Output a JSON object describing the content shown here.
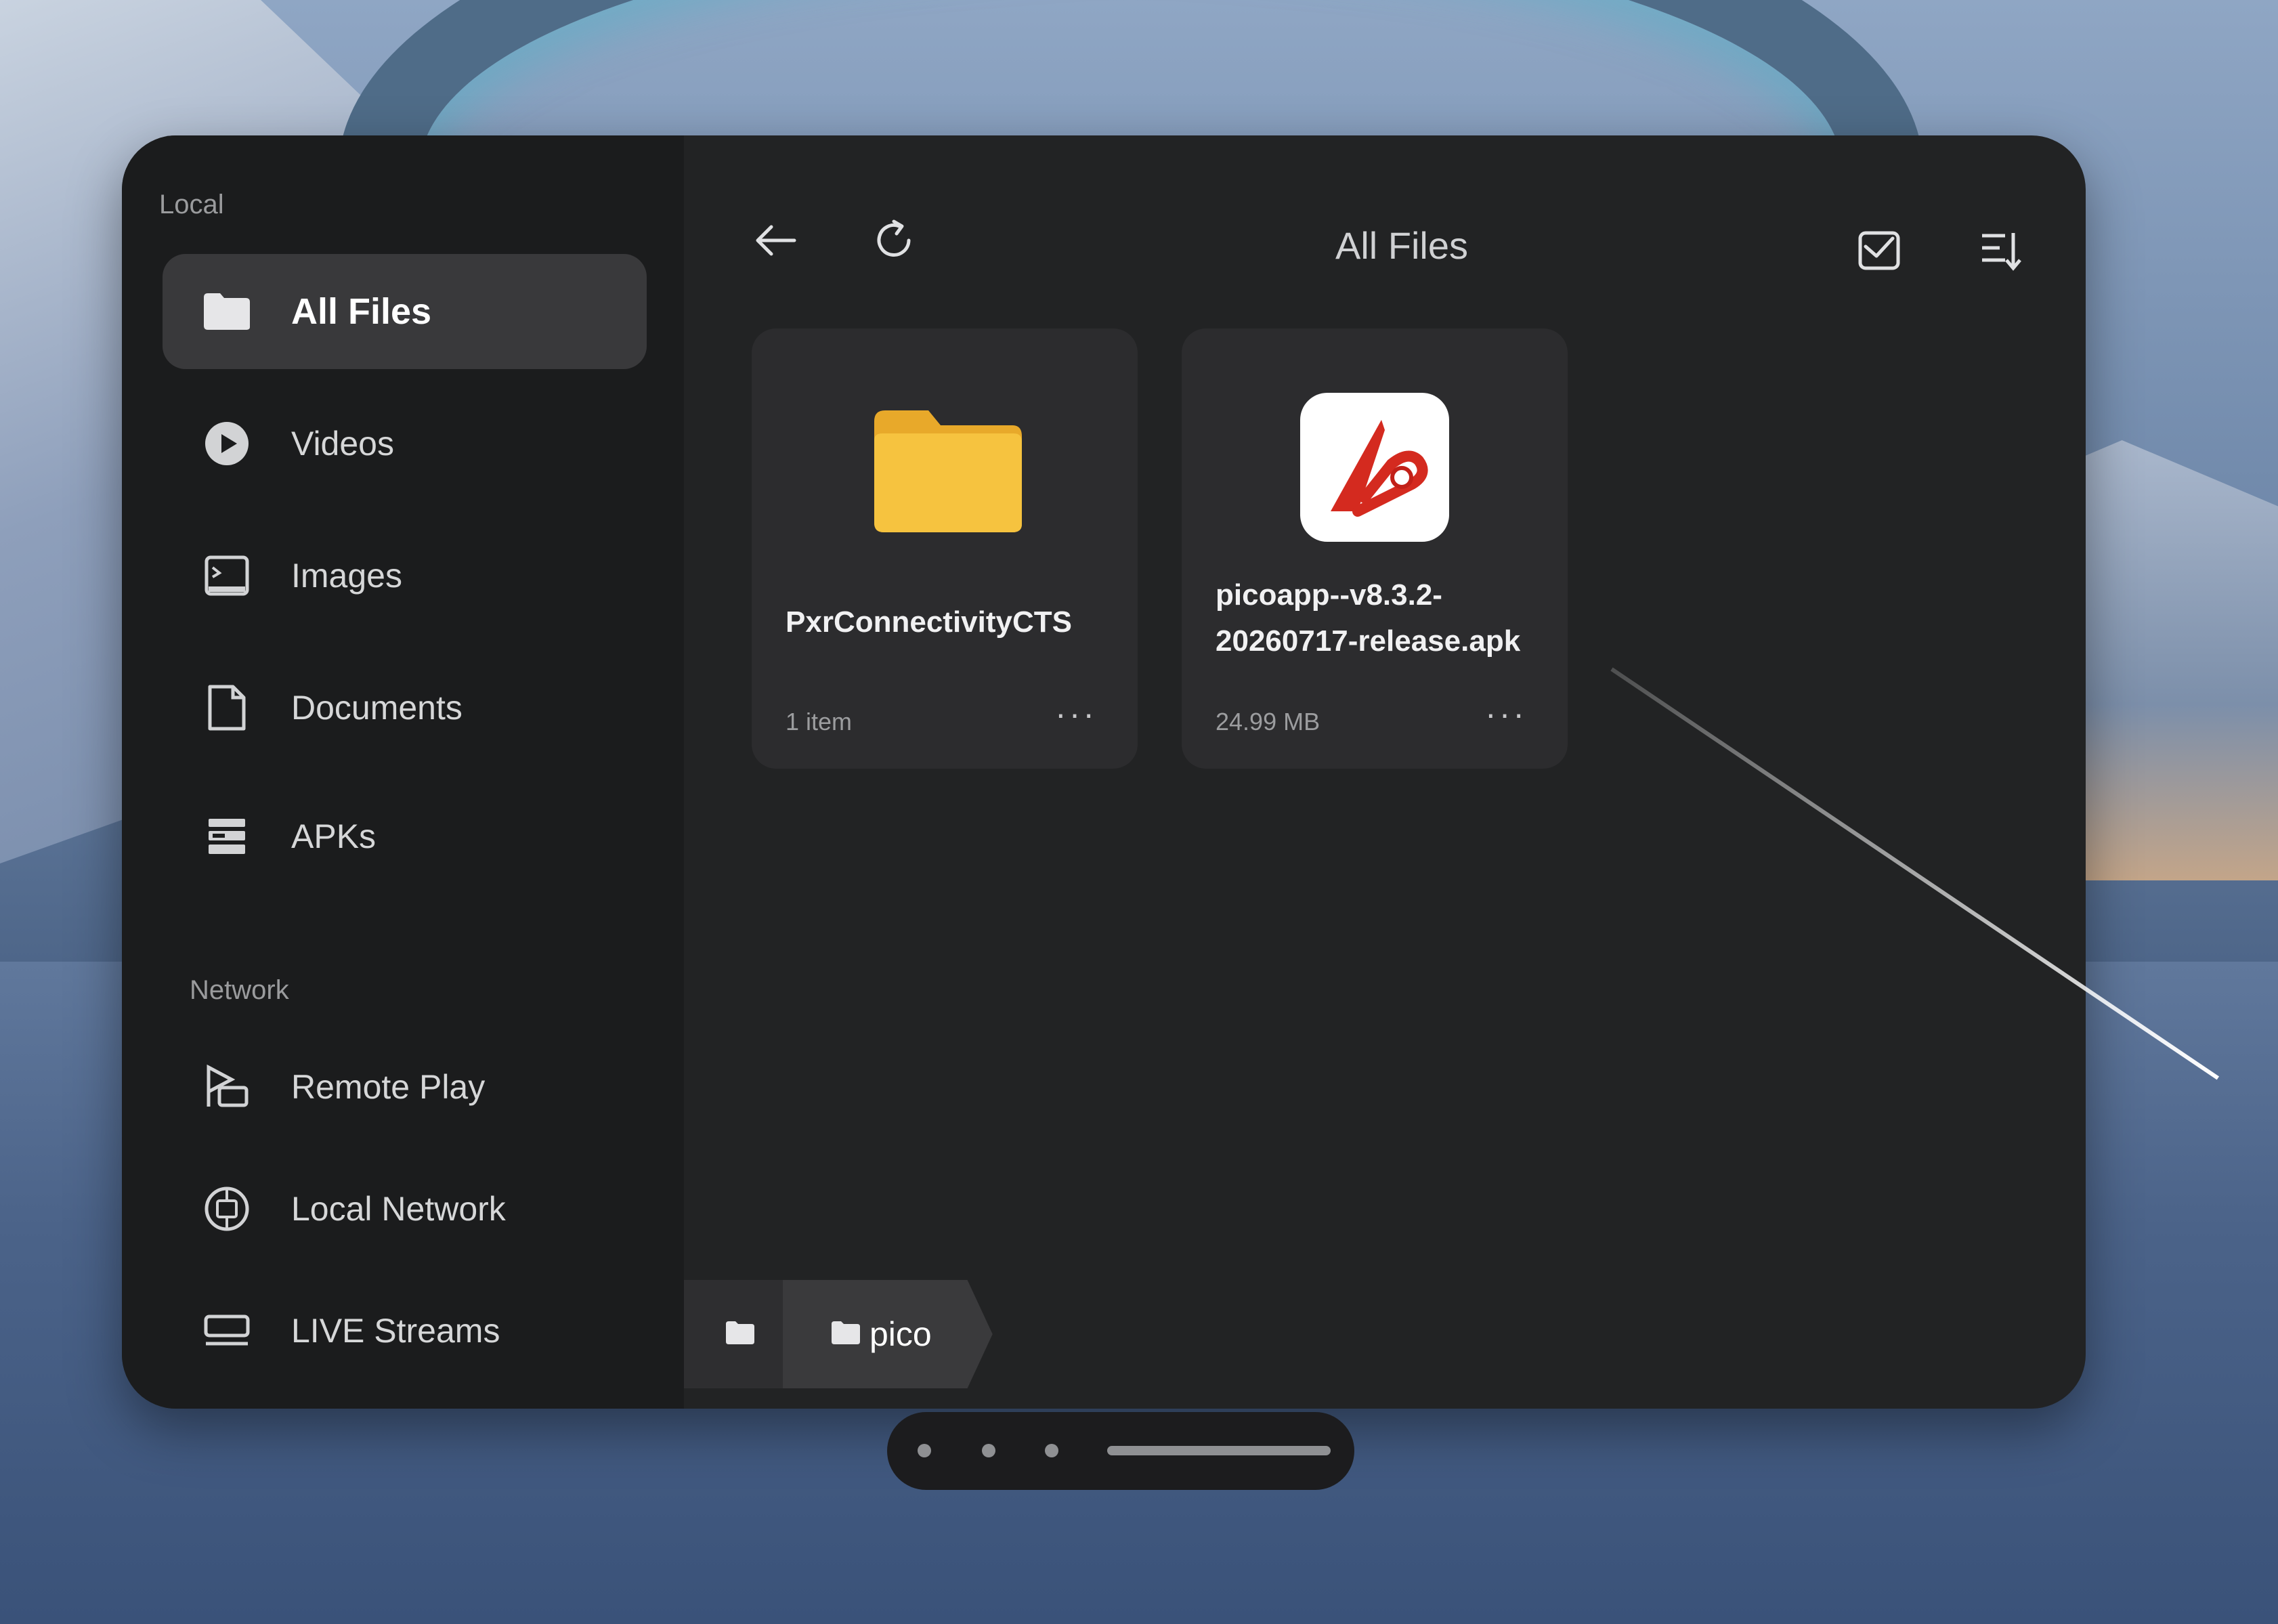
{
  "colors": {
    "panel": "#222324",
    "sidebar": "#1b1c1d",
    "active_item": "#39393b",
    "card": "#2c2c2e",
    "folder_yellow": "#f6c33f",
    "accent_blue": "#4d8dff"
  },
  "sidebar": {
    "local_label": "Local",
    "network_label": "Network",
    "local_items": [
      {
        "label": "All Files",
        "icon": "folder-icon",
        "active": true
      },
      {
        "label": "Videos",
        "icon": "play-circle-icon"
      },
      {
        "label": "Images",
        "icon": "image-icon"
      },
      {
        "label": "Documents",
        "icon": "document-icon"
      },
      {
        "label": "APKs",
        "icon": "apk-stack-icon"
      }
    ],
    "network_items": [
      {
        "label": "Remote Play",
        "icon": "remote-play-icon"
      },
      {
        "label": "Local Network",
        "icon": "local-network-icon"
      },
      {
        "label": "LIVE Streams",
        "icon": "live-streams-icon"
      }
    ]
  },
  "toolbar": {
    "title": "All Files",
    "back_icon": "arrow-left-icon",
    "refresh_icon": "refresh-icon",
    "select_icon": "select-mail-icon",
    "sort_icon": "sort-icon",
    "view_icon": "grid-view-icon"
  },
  "files": [
    {
      "name": "PxrConnectivityCTS",
      "meta": "1 item",
      "more": "···",
      "icon": "folder-icon"
    },
    {
      "name": "picoapp--v8.3.2-20260717-release.apk",
      "meta": "24.99 MB",
      "more": "···",
      "icon": "apk-app-icon"
    }
  ],
  "breadcrumb": [
    {
      "label": "",
      "icon": "folder-icon"
    },
    {
      "label": "pico",
      "icon": "folder-icon"
    }
  ]
}
